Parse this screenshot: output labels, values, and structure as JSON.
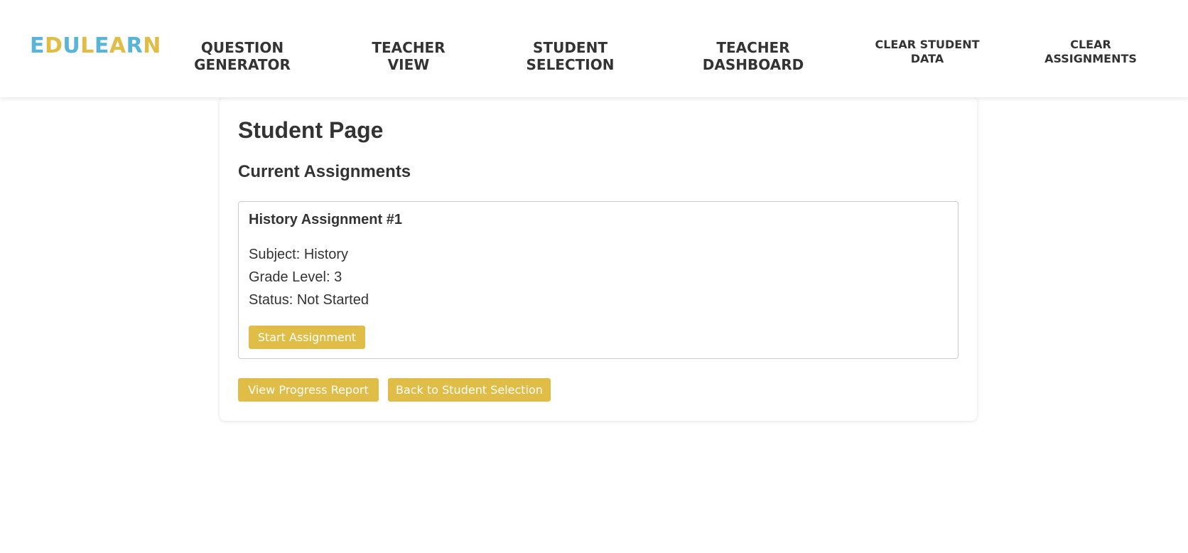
{
  "colors": {
    "accent": "#dfbd46",
    "logo_blue": "#5ab4d8",
    "logo_yellow": "#dfbd46",
    "text": "#333333"
  },
  "logo": {
    "letters": [
      "E",
      "D",
      "U",
      "L",
      "E",
      "A",
      "R",
      "N"
    ]
  },
  "nav": {
    "question_generator": "QUESTION GENERATOR",
    "teacher_view": "TEACHER VIEW",
    "student_selection": "STUDENT SELECTION",
    "teacher_dashboard": "TEACHER DASHBOARD",
    "clear_student_data": "CLEAR STUDENT DATA",
    "clear_assignments": "CLEAR ASSIGNMENTS"
  },
  "main": {
    "page_title": "Student Page",
    "section_title": "Current Assignments",
    "assignments": [
      {
        "title": "History Assignment #1",
        "subject": "Subject: History",
        "grade": "Grade Level: 3",
        "status": "Status: Not Started",
        "start_label": "Start Assignment"
      }
    ],
    "progress_label": "View Progress Report",
    "back_label": "Back to Student Selection"
  }
}
